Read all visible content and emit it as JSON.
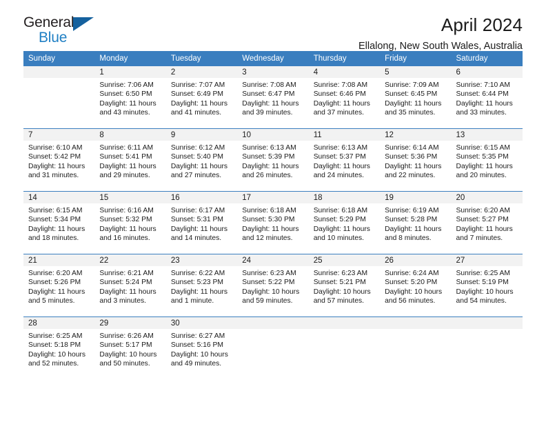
{
  "brand": {
    "name_top": "General",
    "name_bottom": "Blue",
    "triangle_color": "#15619e",
    "blue_text_color": "#1f7fc4"
  },
  "header": {
    "title": "April 2024",
    "subtitle": "Ellalong, New South Wales, Australia",
    "header_bg_color": "#3a7ebf",
    "daynum_bg_color": "#f2f2f2"
  },
  "weekday_headers": [
    "Sunday",
    "Monday",
    "Tuesday",
    "Wednesday",
    "Thursday",
    "Friday",
    "Saturday"
  ],
  "labels": {
    "sunrise_prefix": "Sunrise:",
    "sunset_prefix": "Sunset:",
    "daylight_prefix": "Daylight:"
  },
  "weeks": [
    [
      {
        "day": "",
        "empty": true,
        "sunrise": "",
        "sunset": "",
        "daylight": ""
      },
      {
        "day": "1",
        "empty": false,
        "sunrise": "Sunrise: 7:06 AM",
        "sunset": "Sunset: 6:50 PM",
        "daylight": "Daylight: 11 hours and 43 minutes."
      },
      {
        "day": "2",
        "empty": false,
        "sunrise": "Sunrise: 7:07 AM",
        "sunset": "Sunset: 6:49 PM",
        "daylight": "Daylight: 11 hours and 41 minutes."
      },
      {
        "day": "3",
        "empty": false,
        "sunrise": "Sunrise: 7:08 AM",
        "sunset": "Sunset: 6:47 PM",
        "daylight": "Daylight: 11 hours and 39 minutes."
      },
      {
        "day": "4",
        "empty": false,
        "sunrise": "Sunrise: 7:08 AM",
        "sunset": "Sunset: 6:46 PM",
        "daylight": "Daylight: 11 hours and 37 minutes."
      },
      {
        "day": "5",
        "empty": false,
        "sunrise": "Sunrise: 7:09 AM",
        "sunset": "Sunset: 6:45 PM",
        "daylight": "Daylight: 11 hours and 35 minutes."
      },
      {
        "day": "6",
        "empty": false,
        "sunrise": "Sunrise: 7:10 AM",
        "sunset": "Sunset: 6:44 PM",
        "daylight": "Daylight: 11 hours and 33 minutes."
      }
    ],
    [
      {
        "day": "7",
        "empty": false,
        "sunrise": "Sunrise: 6:10 AM",
        "sunset": "Sunset: 5:42 PM",
        "daylight": "Daylight: 11 hours and 31 minutes."
      },
      {
        "day": "8",
        "empty": false,
        "sunrise": "Sunrise: 6:11 AM",
        "sunset": "Sunset: 5:41 PM",
        "daylight": "Daylight: 11 hours and 29 minutes."
      },
      {
        "day": "9",
        "empty": false,
        "sunrise": "Sunrise: 6:12 AM",
        "sunset": "Sunset: 5:40 PM",
        "daylight": "Daylight: 11 hours and 27 minutes."
      },
      {
        "day": "10",
        "empty": false,
        "sunrise": "Sunrise: 6:13 AM",
        "sunset": "Sunset: 5:39 PM",
        "daylight": "Daylight: 11 hours and 26 minutes."
      },
      {
        "day": "11",
        "empty": false,
        "sunrise": "Sunrise: 6:13 AM",
        "sunset": "Sunset: 5:37 PM",
        "daylight": "Daylight: 11 hours and 24 minutes."
      },
      {
        "day": "12",
        "empty": false,
        "sunrise": "Sunrise: 6:14 AM",
        "sunset": "Sunset: 5:36 PM",
        "daylight": "Daylight: 11 hours and 22 minutes."
      },
      {
        "day": "13",
        "empty": false,
        "sunrise": "Sunrise: 6:15 AM",
        "sunset": "Sunset: 5:35 PM",
        "daylight": "Daylight: 11 hours and 20 minutes."
      }
    ],
    [
      {
        "day": "14",
        "empty": false,
        "sunrise": "Sunrise: 6:15 AM",
        "sunset": "Sunset: 5:34 PM",
        "daylight": "Daylight: 11 hours and 18 minutes."
      },
      {
        "day": "15",
        "empty": false,
        "sunrise": "Sunrise: 6:16 AM",
        "sunset": "Sunset: 5:32 PM",
        "daylight": "Daylight: 11 hours and 16 minutes."
      },
      {
        "day": "16",
        "empty": false,
        "sunrise": "Sunrise: 6:17 AM",
        "sunset": "Sunset: 5:31 PM",
        "daylight": "Daylight: 11 hours and 14 minutes."
      },
      {
        "day": "17",
        "empty": false,
        "sunrise": "Sunrise: 6:18 AM",
        "sunset": "Sunset: 5:30 PM",
        "daylight": "Daylight: 11 hours and 12 minutes."
      },
      {
        "day": "18",
        "empty": false,
        "sunrise": "Sunrise: 6:18 AM",
        "sunset": "Sunset: 5:29 PM",
        "daylight": "Daylight: 11 hours and 10 minutes."
      },
      {
        "day": "19",
        "empty": false,
        "sunrise": "Sunrise: 6:19 AM",
        "sunset": "Sunset: 5:28 PM",
        "daylight": "Daylight: 11 hours and 8 minutes."
      },
      {
        "day": "20",
        "empty": false,
        "sunrise": "Sunrise: 6:20 AM",
        "sunset": "Sunset: 5:27 PM",
        "daylight": "Daylight: 11 hours and 7 minutes."
      }
    ],
    [
      {
        "day": "21",
        "empty": false,
        "sunrise": "Sunrise: 6:20 AM",
        "sunset": "Sunset: 5:26 PM",
        "daylight": "Daylight: 11 hours and 5 minutes."
      },
      {
        "day": "22",
        "empty": false,
        "sunrise": "Sunrise: 6:21 AM",
        "sunset": "Sunset: 5:24 PM",
        "daylight": "Daylight: 11 hours and 3 minutes."
      },
      {
        "day": "23",
        "empty": false,
        "sunrise": "Sunrise: 6:22 AM",
        "sunset": "Sunset: 5:23 PM",
        "daylight": "Daylight: 11 hours and 1 minute."
      },
      {
        "day": "24",
        "empty": false,
        "sunrise": "Sunrise: 6:23 AM",
        "sunset": "Sunset: 5:22 PM",
        "daylight": "Daylight: 10 hours and 59 minutes."
      },
      {
        "day": "25",
        "empty": false,
        "sunrise": "Sunrise: 6:23 AM",
        "sunset": "Sunset: 5:21 PM",
        "daylight": "Daylight: 10 hours and 57 minutes."
      },
      {
        "day": "26",
        "empty": false,
        "sunrise": "Sunrise: 6:24 AM",
        "sunset": "Sunset: 5:20 PM",
        "daylight": "Daylight: 10 hours and 56 minutes."
      },
      {
        "day": "27",
        "empty": false,
        "sunrise": "Sunrise: 6:25 AM",
        "sunset": "Sunset: 5:19 PM",
        "daylight": "Daylight: 10 hours and 54 minutes."
      }
    ],
    [
      {
        "day": "28",
        "empty": false,
        "sunrise": "Sunrise: 6:25 AM",
        "sunset": "Sunset: 5:18 PM",
        "daylight": "Daylight: 10 hours and 52 minutes."
      },
      {
        "day": "29",
        "empty": false,
        "sunrise": "Sunrise: 6:26 AM",
        "sunset": "Sunset: 5:17 PM",
        "daylight": "Daylight: 10 hours and 50 minutes."
      },
      {
        "day": "30",
        "empty": false,
        "sunrise": "Sunrise: 6:27 AM",
        "sunset": "Sunset: 5:16 PM",
        "daylight": "Daylight: 10 hours and 49 minutes."
      },
      {
        "day": "",
        "empty": true,
        "sunrise": "",
        "sunset": "",
        "daylight": ""
      },
      {
        "day": "",
        "empty": true,
        "sunrise": "",
        "sunset": "",
        "daylight": ""
      },
      {
        "day": "",
        "empty": true,
        "sunrise": "",
        "sunset": "",
        "daylight": ""
      },
      {
        "day": "",
        "empty": true,
        "sunrise": "",
        "sunset": "",
        "daylight": ""
      }
    ]
  ]
}
